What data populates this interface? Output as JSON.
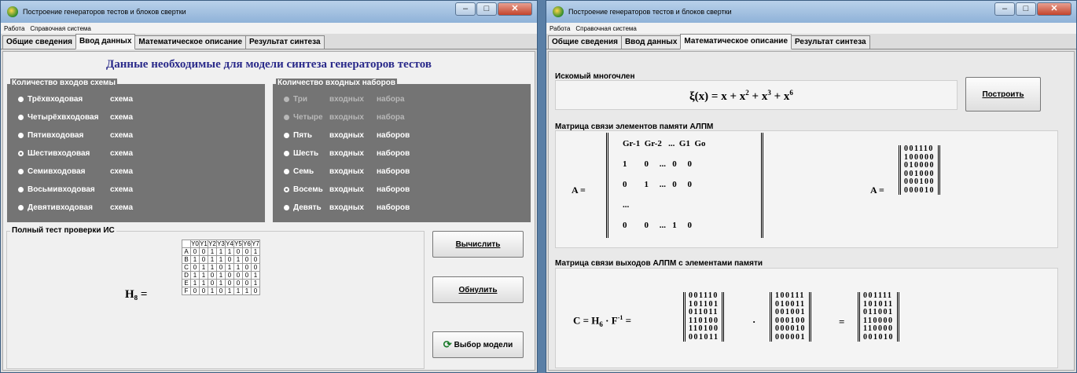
{
  "window1": {
    "title": "Построение генераторов тестов и блоков свертки",
    "menu": [
      "Работа",
      "Справочная система"
    ],
    "tabs": [
      "Общие сведения",
      "Ввод данных",
      "Математическое описание",
      "Результат синтеза"
    ],
    "active_tab": 1,
    "heading": "Данные необходимые для модели синтеза генераторов тестов",
    "inputs_group": {
      "title": "Количество входов схемы",
      "options": [
        {
          "word": "Трёхвходовая",
          "suffix": "схема",
          "selected": false
        },
        {
          "word": "Четырёхвходовая",
          "suffix": "схема",
          "selected": false
        },
        {
          "word": "Пятивходовая",
          "suffix": "схема",
          "selected": false
        },
        {
          "word": "Шестивходовая",
          "suffix": "схема",
          "selected": true
        },
        {
          "word": "Семивходовая",
          "suffix": "схема",
          "selected": false
        },
        {
          "word": "Восьмивходовая",
          "suffix": "схема",
          "selected": false
        },
        {
          "word": "Девятивходовая",
          "suffix": "схема",
          "selected": false
        }
      ]
    },
    "sets_group": {
      "title": "Количество входных наборов",
      "options": [
        {
          "w1": "Три",
          "w2": "входных",
          "w3": "набора",
          "selected": false,
          "disabled": true
        },
        {
          "w1": "Четыре",
          "w2": "входных",
          "w3": "набора",
          "selected": false,
          "disabled": true
        },
        {
          "w1": "Пять",
          "w2": "входных",
          "w3": "наборов",
          "selected": false,
          "disabled": false
        },
        {
          "w1": "Шесть",
          "w2": "входных",
          "w3": "наборов",
          "selected": false,
          "disabled": false
        },
        {
          "w1": "Семь",
          "w2": "входных",
          "w3": "наборов",
          "selected": false,
          "disabled": false
        },
        {
          "w1": "Восемь",
          "w2": "входных",
          "w3": "наборов",
          "selected": true,
          "disabled": false
        },
        {
          "w1": "Девять",
          "w2": "входных",
          "w3": "наборов",
          "selected": false,
          "disabled": false
        }
      ]
    },
    "test_group": {
      "title": "Полный тест проверки ИС",
      "label": "H₈  =",
      "columns": [
        "Y0",
        "Y1",
        "Y2",
        "Y3",
        "Y4",
        "Y5",
        "Y6",
        "Y7"
      ],
      "rows": [
        {
          "name": "A",
          "values": [
            "0",
            "0",
            "1",
            "1",
            "1",
            "0",
            "0",
            "1"
          ]
        },
        {
          "name": "B",
          "values": [
            "1",
            "0",
            "1",
            "1",
            "0",
            "1",
            "0",
            "0"
          ]
        },
        {
          "name": "C",
          "values": [
            "0",
            "1",
            "1",
            "0",
            "1",
            "1",
            "0",
            "0"
          ]
        },
        {
          "name": "D",
          "values": [
            "1",
            "1",
            "0",
            "1",
            "0",
            "0",
            "0",
            "1"
          ]
        },
        {
          "name": "E",
          "values": [
            "1",
            "1",
            "0",
            "1",
            "0",
            "0",
            "0",
            "1"
          ]
        },
        {
          "name": "F",
          "values": [
            "0",
            "0",
            "1",
            "0",
            "1",
            "1",
            "1",
            "0"
          ]
        }
      ]
    },
    "buttons": {
      "compute": "Вычислить",
      "reset": "Обнулить",
      "model": "Выбор модели"
    }
  },
  "window2": {
    "title": "Построение генераторов тестов и блоков свертки",
    "menu": [
      "Работа",
      "Справочная система"
    ],
    "tabs": [
      "Общие сведения",
      "Ввод данных",
      "Математическое описание",
      "Результат синтеза"
    ],
    "active_tab": 2,
    "poly": {
      "label": "Искомый многочлен",
      "lhs": "ξ(x) = x + x",
      "e1": "2",
      "mid1": " + x",
      "e2": "3",
      "mid2": " + x",
      "e3": "6"
    },
    "build_button": "Построить",
    "memory": {
      "label": "Матрица связи элементов памяти АЛПМ",
      "A": "A =",
      "sym_rows": [
        "Gr-1  Gr-2   ...  G1  Go",
        "1        0     ...   0     0",
        "0        1     ...   0     0",
        "...",
        "0        0     ...   1     0"
      ],
      "num_rows": [
        "001110",
        "100000",
        "010000",
        "001000",
        "000100",
        "000010"
      ]
    },
    "outputs": {
      "label": "Матрица связи выходов АЛПМ с элементами памяти",
      "lhs": "C = H",
      "sub": "6",
      "mid": " · F",
      "sup": "-1",
      "eq": " =",
      "dot": "·",
      "eq2": "=",
      "m1": [
        "001110",
        "101101",
        "011011",
        "110100",
        "110100",
        "001011"
      ],
      "m2": [
        "100111",
        "010011",
        "001001",
        "000100",
        "000010",
        "000001"
      ],
      "m3": [
        "001111",
        "101011",
        "011001",
        "110000",
        "110000",
        "001010"
      ]
    }
  }
}
